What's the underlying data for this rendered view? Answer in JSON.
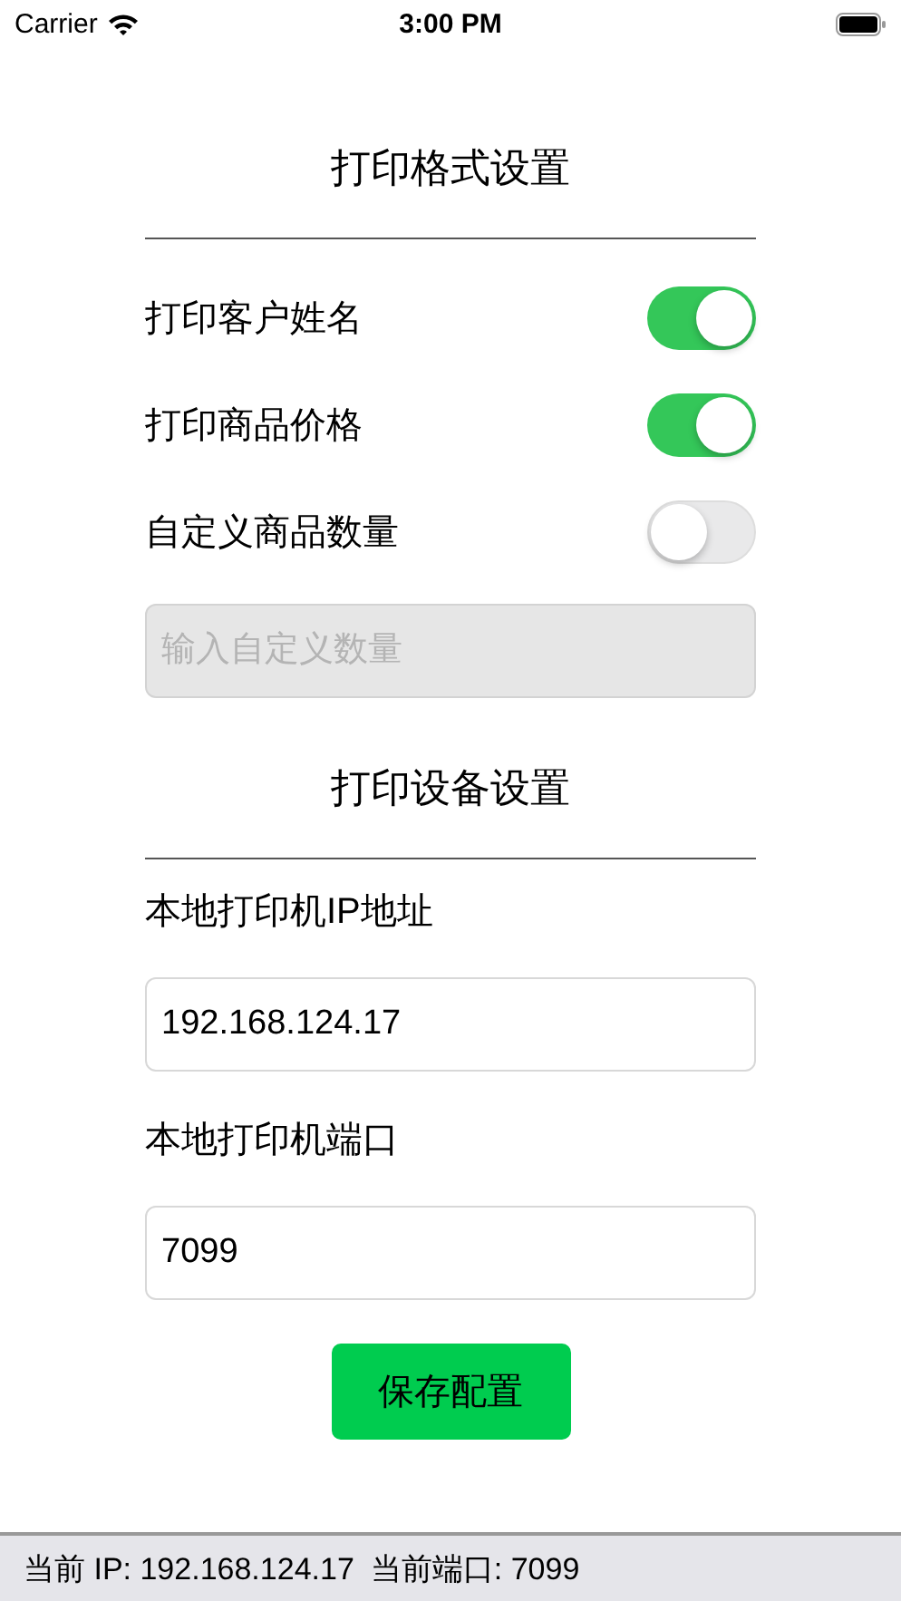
{
  "status_bar": {
    "carrier": "Carrier",
    "time": "3:00 PM"
  },
  "sections": [
    {
      "title": "打印格式设置",
      "items": [
        {
          "kind": "switch",
          "label": "打印客户姓名",
          "on": true
        },
        {
          "kind": "switch",
          "label": "打印商品价格",
          "on": true
        },
        {
          "kind": "switch",
          "label": "自定义商品数量",
          "on": false
        },
        {
          "kind": "field",
          "placeholder": "输入自定义数量",
          "disabled": true
        }
      ]
    },
    {
      "title": "打印设备设置",
      "items": [
        {
          "kind": "label",
          "label": "本地打印机IP地址"
        },
        {
          "kind": "field",
          "value": "192.168.124.17",
          "disabled": false
        },
        {
          "kind": "label",
          "label": "本地打印机端口"
        },
        {
          "kind": "field",
          "value": "7099",
          "disabled": false
        }
      ]
    }
  ],
  "save_button": "保存配置",
  "footer": [
    "当前 IP: 192.168.124.17",
    "当前端口: 7099"
  ]
}
